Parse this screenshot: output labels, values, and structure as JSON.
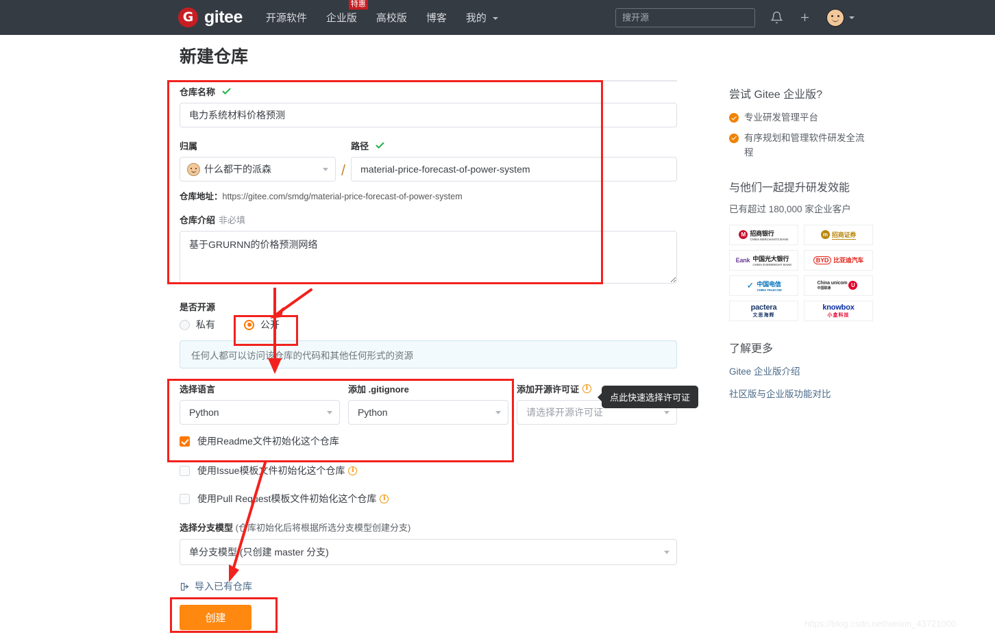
{
  "header": {
    "brand_mark": "G",
    "brand_name": "gitee",
    "nav": [
      {
        "label": "开源软件",
        "badge": ""
      },
      {
        "label": "企业版",
        "badge": "特惠"
      },
      {
        "label": "高校版",
        "badge": ""
      },
      {
        "label": "博客",
        "badge": ""
      },
      {
        "label": "我的",
        "badge": "",
        "has_caret": true
      }
    ],
    "search_placeholder": "搜开源",
    "bell_icon": "bell-icon",
    "plus_icon": "plus-icon",
    "avatar_icon": "user-avatar"
  },
  "page": {
    "title": "新建仓库"
  },
  "form": {
    "name_label": "仓库名称",
    "name_value": "电力系统材料价格预测",
    "name_valid_icon": "check-icon",
    "owner_label": "归属",
    "owner_value": "什么都干的派森",
    "path_label": "路径",
    "path_valid_icon": "check-icon",
    "path_value": "material-price-forecast-of-power-system",
    "separator": "/",
    "repo_url_label": "仓库地址：",
    "repo_url_value": "https://gitee.com/smdg/material-price-forecast-of-power-system",
    "desc_label": "仓库介绍",
    "desc_optional": "非必填",
    "desc_value": "基于GRURNN的价格预测网络",
    "open_source_label": "是否开源",
    "radio_private": "私有",
    "radio_public": "公开",
    "selected_visibility": "公开",
    "public_note": "任何人都可以访问该仓库的代码和其他任何形式的资源",
    "language_label": "选择语言",
    "language_value": "Python",
    "gitignore_label": "添加 .gitignore",
    "gitignore_value": "Python",
    "license_label": "添加开源许可证",
    "license_value": "请选择开源许可证",
    "license_info_icon": "info-icon",
    "license_tooltip": "点此快速选择许可证",
    "readme_checkbox": "使用Readme文件初始化这个仓库",
    "readme_checked": true,
    "issue_checkbox": "使用Issue模板文件初始化这个仓库",
    "issue_checked": false,
    "pr_checkbox": "使用Pull Request模板文件初始化这个仓库",
    "pr_checked": false,
    "branch_label": "选择分支模型",
    "branch_hint": "(仓库初始化后将根据所选分支模型创建分支)",
    "branch_value": "单分支模型 (只创建 master 分支)",
    "import_link": "导入已有仓库",
    "import_icon": "import-icon",
    "create_button": "创建"
  },
  "sidebar": {
    "heading": "尝试 Gitee 企业版?",
    "features": [
      "专业研发管理平台",
      "有序规划和管理软件研发全流程"
    ],
    "partners_heading": "与他们一起提升研发效能",
    "partners_sub": "已有超过 180,000 家企业客户",
    "logos": [
      {
        "name": "招商银行",
        "sub": "CHINA MERCHANTS BANK",
        "color": "#c8102e",
        "mark": "M"
      },
      {
        "name": "招商证券",
        "sub": "",
        "color": "#b8860b",
        "mark": "m"
      },
      {
        "name": "中国光大银行",
        "sub": "CHINA EVERBRIGHT BANK",
        "color": "#6a3d9a",
        "mark": "E"
      },
      {
        "name": "比亚迪汽车",
        "sub": "",
        "color": "#e2231a",
        "mark": "BYD"
      },
      {
        "name": "中国电信",
        "sub": "CHINA TELECOM",
        "color": "#0072bc",
        "mark": "C"
      },
      {
        "name": "中国联通",
        "sub": "China unicom",
        "color": "#e4002b",
        "mark": "U"
      },
      {
        "name": "pactera",
        "sub": "文思海辉",
        "color": "#1a3668",
        "mark": ""
      },
      {
        "name": "knowbox",
        "sub": "小盒科技",
        "color": "#0a2ea0",
        "mark": ""
      }
    ],
    "more_heading": "了解更多",
    "more_links": [
      "Gitee 企业版介绍",
      "社区版与企业版功能对比"
    ]
  },
  "watermark": "https://blog.csdn.net/weixin_43721000",
  "annotation_color": "#f2211d"
}
